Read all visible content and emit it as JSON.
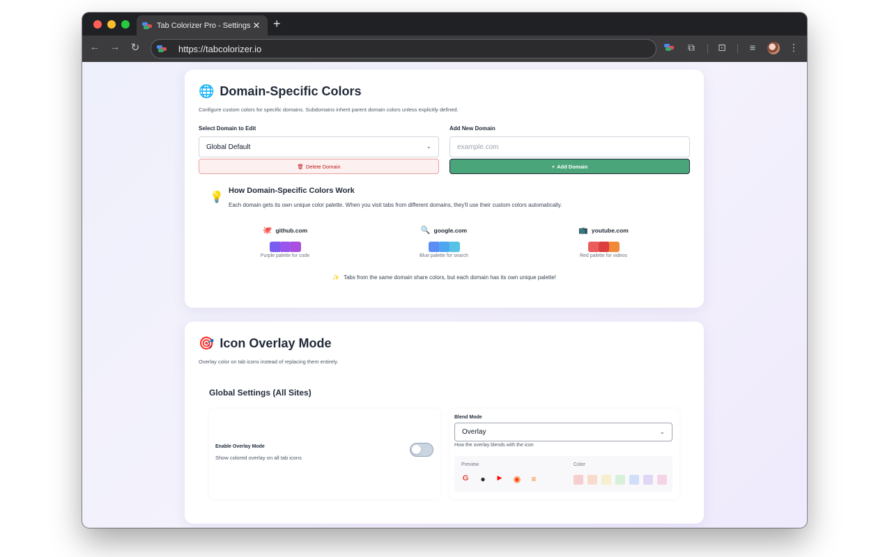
{
  "browser": {
    "tab_title": "Tab Colorizer Pro - Settings",
    "tab_close": "✕",
    "new_tab": "+",
    "url": "https://tabcolorizer.io"
  },
  "domain_section": {
    "icon": "🌐",
    "title": "Domain-Specific Colors",
    "description": "Configure custom colors for specific domains. Subdomains inherit parent domain colors unless explicitly defined.",
    "select_label": "Select Domain to Edit",
    "select_value": "Global Default",
    "add_label": "Add New Domain",
    "add_placeholder": "example.com",
    "delete_button": "Delete Domain",
    "add_button": "Add Domain",
    "how_title": "How Domain-Specific Colors Work",
    "how_desc": "Each domain gets its own unique color palette. When you visit tabs from different domains, they'll use their custom colors automatically.",
    "examples": [
      {
        "icon": "🐙",
        "domain": "github.com",
        "caption": "Purple palette for code",
        "colors": [
          "#7b5cf0",
          "#9b55ec",
          "#a94fe0"
        ]
      },
      {
        "icon": "🔍",
        "domain": "google.com",
        "caption": "Blue palette for search",
        "colors": [
          "#5b8ef5",
          "#4fa6f0",
          "#55c3e6"
        ]
      },
      {
        "icon": "📺",
        "domain": "youtube.com",
        "caption": "Red palette for videos",
        "colors": [
          "#e85c5c",
          "#db3f3f",
          "#f08a3a"
        ]
      }
    ],
    "tip_icon": "✨",
    "tip": "Tabs from the same domain share colors, but each domain has its own unique palette!"
  },
  "overlay_section": {
    "icon": "🎯",
    "title": "Icon Overlay Mode",
    "description": "Overlay color on tab icons instead of replacing them entirely.",
    "global_title": "Global Settings (All Sites)",
    "enable_label": "Enable Overlay Mode",
    "enable_desc": "Show colored overlay on all tab icons",
    "enabled": false,
    "blend_label": "Blend Mode",
    "blend_value": "Overlay",
    "blend_desc": "How the overlay blends with the icon",
    "preview_label": "Preview",
    "color_label": "Color",
    "preview_icons": [
      {
        "name": "google-icon",
        "glyph": "G",
        "color": "#ea4335"
      },
      {
        "name": "github-icon",
        "glyph": "●",
        "color": "#24292e"
      },
      {
        "name": "youtube-icon",
        "glyph": "▶",
        "color": "#ff0000"
      },
      {
        "name": "reddit-icon",
        "glyph": "◉",
        "color": "#ff4500"
      },
      {
        "name": "stackoverflow-icon",
        "glyph": "≡",
        "color": "#f48024"
      }
    ],
    "colors": [
      "#f4a3a3",
      "#f7c09c",
      "#f6e3a2",
      "#b7e6b9",
      "#a9c4f5",
      "#c8b4f2",
      "#f0aed3"
    ]
  }
}
